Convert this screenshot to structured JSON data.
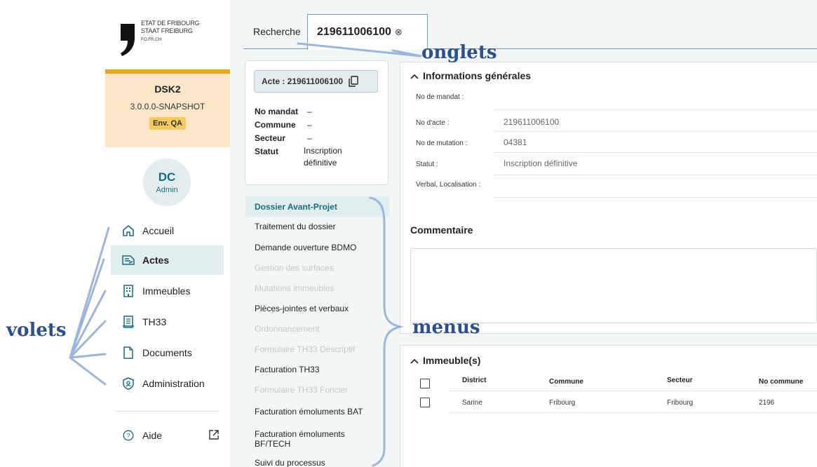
{
  "logo": {
    "line1": "ETAT DE FRIBOURG",
    "line2": "STAAT FREIBURG",
    "line3": "FO.FR.CH"
  },
  "env": {
    "app": "DSK2",
    "version": "3.0.0.0-SNAPSHOT",
    "badge": "Env. QA",
    "accent": "#e8a317"
  },
  "user": {
    "initials": "DC",
    "role": "Admin"
  },
  "nav": {
    "items": [
      {
        "label": "Accueil",
        "icon": "home-icon"
      },
      {
        "label": "Actes",
        "icon": "deed-icon"
      },
      {
        "label": "Immeubles",
        "icon": "building-icon"
      },
      {
        "label": "TH33",
        "icon": "register-icon"
      },
      {
        "label": "Documents",
        "icon": "document-icon"
      },
      {
        "label": "Administration",
        "icon": "shield-icon"
      }
    ],
    "help": "Aide"
  },
  "tabs": {
    "search": "Recherche",
    "active": "219611006100",
    "close": "⊗"
  },
  "summary": {
    "acte_label": "Acte : 219611006100",
    "rows": [
      {
        "k": "No mandat",
        "v": "–"
      },
      {
        "k": "Commune",
        "v": "–"
      },
      {
        "k": "Secteur",
        "v": "–"
      },
      {
        "k": "Statut",
        "v": "Inscription définitive"
      }
    ]
  },
  "menu": [
    {
      "label": "Dossier Avant-Projet",
      "state": "active"
    },
    {
      "label": "Traitement du dossier",
      "state": "enabled"
    },
    {
      "label": "Demande ouverture BDMO",
      "state": "enabled"
    },
    {
      "label": "Gestion des surfaces",
      "state": "disabled"
    },
    {
      "label": "Mutations immeubles",
      "state": "disabled"
    },
    {
      "label": "Pièces-jointes et verbaux",
      "state": "enabled"
    },
    {
      "label": "Ordonnancement",
      "state": "disabled"
    },
    {
      "label": "Formulaire TH33 Descriptif",
      "state": "disabled"
    },
    {
      "label": "Facturation TH33",
      "state": "enabled"
    },
    {
      "label": "Formulaire TH33 Foncier",
      "state": "disabled"
    },
    {
      "label": "Facturation émoluments BAT",
      "state": "enabled"
    },
    {
      "label": "Facturation émoluments BF/TECH",
      "state": "enabled"
    },
    {
      "label": "Suivi du processus",
      "state": "enabled"
    }
  ],
  "info": {
    "title": "Informations générales",
    "fields": [
      {
        "label": "No de mandat :",
        "value": ""
      },
      {
        "label": "No d'acte :",
        "value": "219611006100"
      },
      {
        "label": "No de mutation :",
        "value": "04381"
      },
      {
        "label": "Statut :",
        "value": "Inscription définitive"
      },
      {
        "label": "Verbal, Localisation :",
        "value": ""
      }
    ],
    "comment_title": "Commentaire"
  },
  "immeubles": {
    "title": "Immeuble(s)",
    "headers": [
      "District",
      "Commune",
      "Secteur",
      "No commune"
    ],
    "rows": [
      [
        "Sarine",
        "Fribourg",
        "Fribourg",
        "2196"
      ]
    ]
  },
  "annotations": {
    "tabs": "onglets",
    "menus": "menus",
    "panes": "volets"
  },
  "colors": {
    "primary": "#1a6b7c",
    "annotation": "#2d4f8e",
    "active_bg": "#e1eef0"
  }
}
